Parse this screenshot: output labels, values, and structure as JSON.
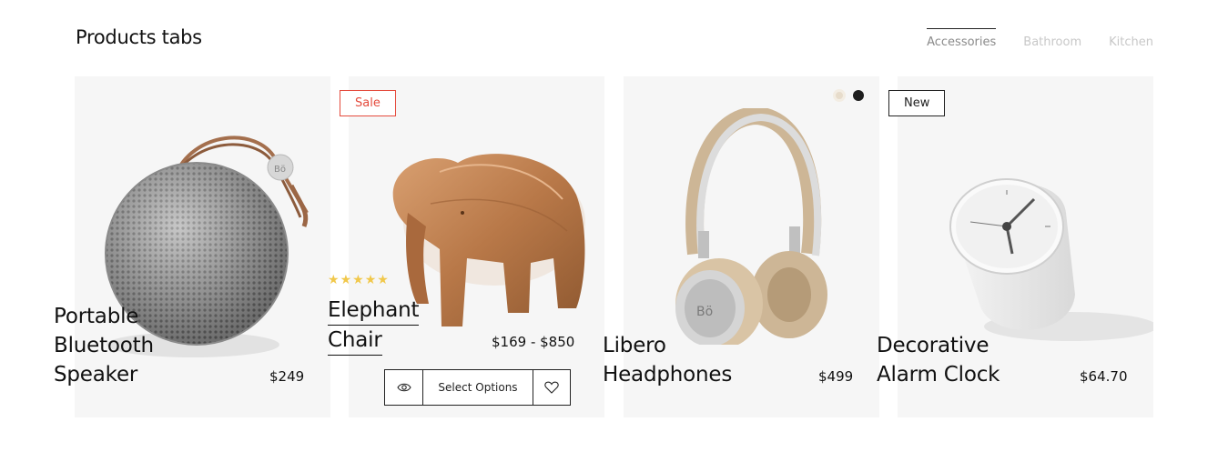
{
  "section": {
    "title": "Products tabs"
  },
  "tabs": [
    {
      "label": "Accessories",
      "active": true
    },
    {
      "label": "Bathroom",
      "active": false
    },
    {
      "label": "Kitchen",
      "active": false
    }
  ],
  "products": [
    {
      "name_lines": [
        "Portable",
        "Bluetooth",
        "Speaker"
      ],
      "price": "$249"
    },
    {
      "name_lines": [
        "Elephant",
        "Chair"
      ],
      "price": "$169 - $850",
      "badge": "Sale",
      "rating": 5,
      "actions": {
        "quick_view_icon": "eye-icon",
        "select_label": "Select Options",
        "wishlist_icon": "heart-icon"
      }
    },
    {
      "name_lines": [
        "Libero",
        "Headphones"
      ],
      "price": "$499",
      "swatches": [
        "#e7dccb",
        "#1e1e1e"
      ]
    },
    {
      "name_lines": [
        "Decorative",
        "Alarm Clock"
      ],
      "price": "$64.70",
      "badge": "New"
    }
  ],
  "colors": {
    "sale": "#e44a3c",
    "star": "#f1c84b",
    "card_bg": "#f6f6f6"
  }
}
